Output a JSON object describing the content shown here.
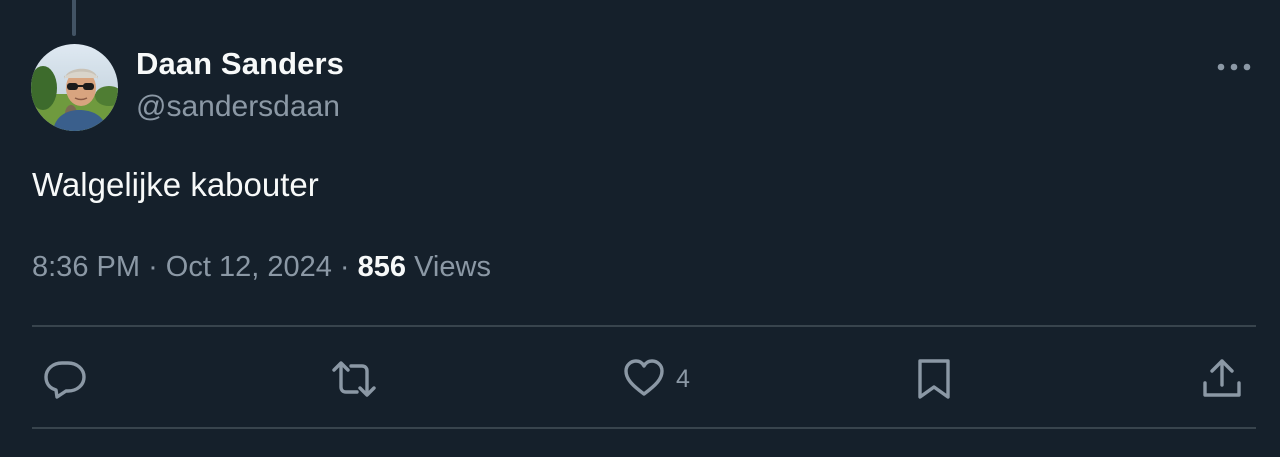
{
  "author": {
    "name": "Daan Sanders",
    "handle": "@sandersdaan"
  },
  "tweet": {
    "text": "Walgelijke kabouter",
    "time": "8:36 PM",
    "separator": "·",
    "date": "Oct 12, 2024",
    "views_count": "856",
    "views_label": "Views"
  },
  "actions": {
    "likes_count": "4"
  },
  "colors": {
    "background": "#15202b",
    "primary_text": "#f7f9f9",
    "secondary_text": "#8b98a5",
    "divider": "#38444d"
  }
}
